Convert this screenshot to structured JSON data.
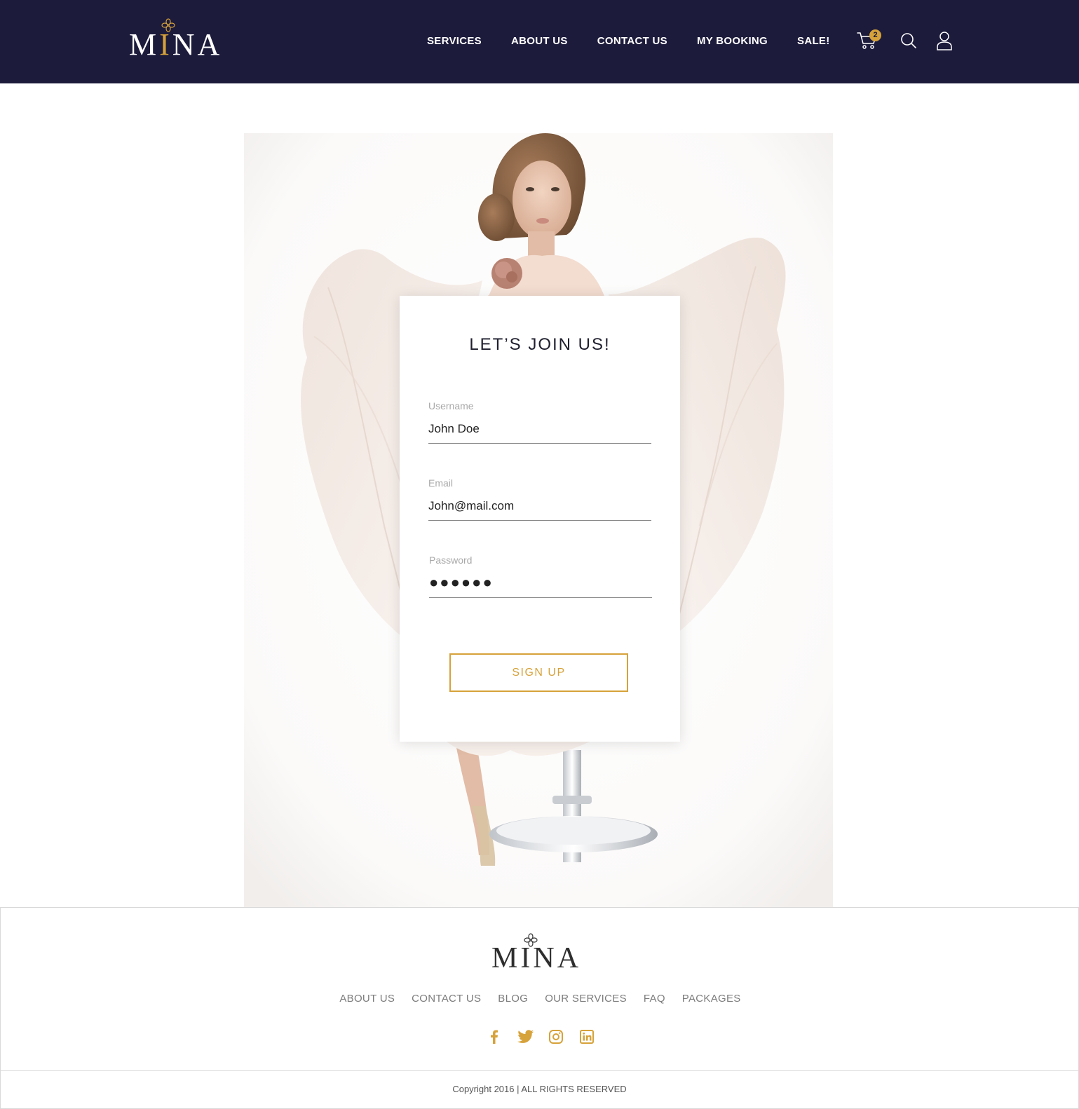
{
  "brand": {
    "name_first": "M",
    "name_accent": "I",
    "name_rest": "NA",
    "accent_color": "#d6a23a",
    "header_bg": "#1c1b3c"
  },
  "nav": [
    "SERVICES",
    "ABOUT US",
    "CONTACT US",
    "MY BOOKING",
    "SALE!"
  ],
  "header_icons": {
    "cart": "cart-icon",
    "cart_count": "2",
    "search": "search-icon",
    "user": "user-icon"
  },
  "form": {
    "title": "LET’S JOIN US!",
    "username": {
      "label": "Username",
      "value": "John Doe"
    },
    "email": {
      "label": "Email",
      "value": "John@mail.com"
    },
    "password": {
      "label": "Password",
      "value": "●●●●●●"
    },
    "submit": "SIGN UP"
  },
  "footer": {
    "nav": [
      "ABOUT US",
      "CONTACT US",
      "BLOG",
      "OUR SERVICES",
      "FAQ",
      "PACKAGES"
    ],
    "social": [
      "facebook-icon",
      "twitter-icon",
      "instagram-icon",
      "linkedin-icon"
    ],
    "copyright": "Copyright 2016 | ALL RIGHTS RESERVED"
  }
}
